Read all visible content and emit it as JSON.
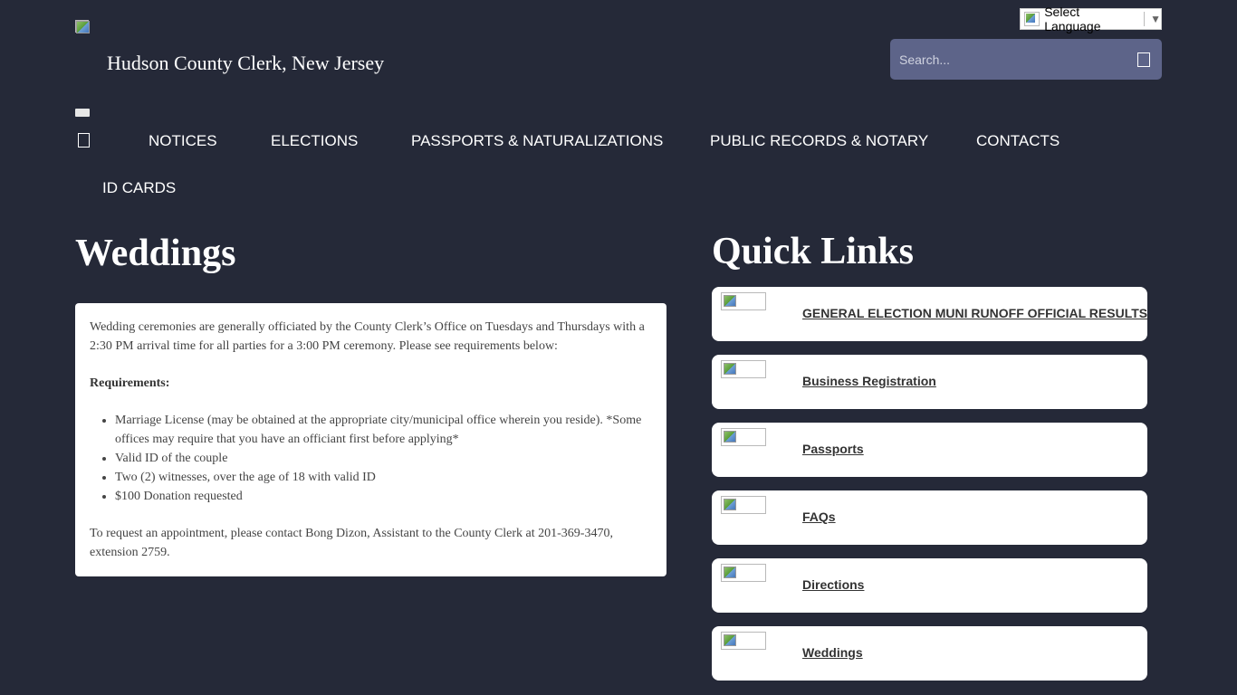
{
  "header": {
    "site_title": "Hudson County Clerk, New Jersey",
    "language_label": "Select Language",
    "language_arrow": "▼",
    "search_placeholder": "Search..."
  },
  "nav": {
    "items": [
      "NOTICES",
      "ELECTIONS",
      "PASSPORTS & NATURALIZATIONS",
      "PUBLIC RECORDS & NOTARY",
      "CONTACTS",
      "ID CARDS"
    ]
  },
  "main": {
    "title": "Weddings",
    "intro": "Wedding ceremonies are generally officiated by the County Clerk’s Office on Tuesdays and Thursdays with a 2:30 PM arrival time for all parties for a 3:00 PM ceremony. Please see requirements below:",
    "requirements_heading": "Requirements:",
    "requirements": [
      "Marriage License (may be obtained at the appropriate city/municipal office wherein you reside). *Some offices may require that you have an officiant first before applying*",
      "Valid ID of the couple",
      "Two (2) witnesses, over the age of 18 with valid ID",
      "$100 Donation requested"
    ],
    "contact": "To request an appointment, please contact Bong Dizon, Assistant to the County Clerk at 201-369-3470, extension 2759."
  },
  "quick_links": {
    "title": "Quick Links",
    "items": [
      "GENERAL ELECTION MUNI RUNOFF OFFICIAL RESULTS",
      "Business Registration",
      "Passports",
      "FAQs",
      "Directions",
      "Weddings"
    ]
  },
  "colors": {
    "background": "#252938",
    "search_bg": "#5d6489",
    "card_bg": "#ffffff"
  }
}
